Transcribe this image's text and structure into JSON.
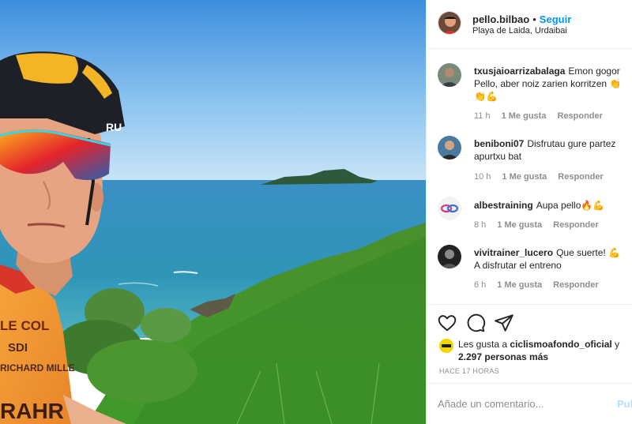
{
  "post": {
    "username": "pello.bilbao",
    "separator": "•",
    "follow_label": "Seguir",
    "location": "Playa de Laida, Urdaibai"
  },
  "comments": [
    {
      "username": "txusjaioarrizabalaga",
      "text": "Emon gogor Pello, aber noiz zarien korritzen 👏👏💪",
      "time": "11 h",
      "likes": "1 Me gusta",
      "reply": "Responder"
    },
    {
      "username": "beniboni07",
      "text": "Disfrutau gure partez apurtxu bat",
      "time": "10 h",
      "likes": "1 Me gusta",
      "reply": "Responder"
    },
    {
      "username": "albestraining",
      "text": "Aupa pello🔥💪",
      "time": "8 h",
      "likes": "1 Me gusta",
      "reply": "Responder"
    },
    {
      "username": "vivitrainer_lucero",
      "text": "Que suerte! 💪 A disfrutar el entreno",
      "time": "6 h",
      "likes": "1 Me gusta",
      "reply": "Responder"
    }
  ],
  "actions": {
    "like_icon": "heart-icon",
    "comment_icon": "comment-bubble-icon",
    "share_icon": "paper-plane-icon"
  },
  "liked_by": {
    "prefix": "Les gusta a",
    "user": "ciclismoafondo_oficial",
    "connector": "y",
    "others": "2.297 personas más"
  },
  "time_ago": "HACE 17 HORAS",
  "add_comment": {
    "placeholder": "Añade un comentario...",
    "publish_label": "Publicar"
  },
  "colors": {
    "link_blue": "#0095f6",
    "publish_disabled": "#b2dffc",
    "muted_text": "#8e8e8e",
    "divider": "#efefef"
  }
}
